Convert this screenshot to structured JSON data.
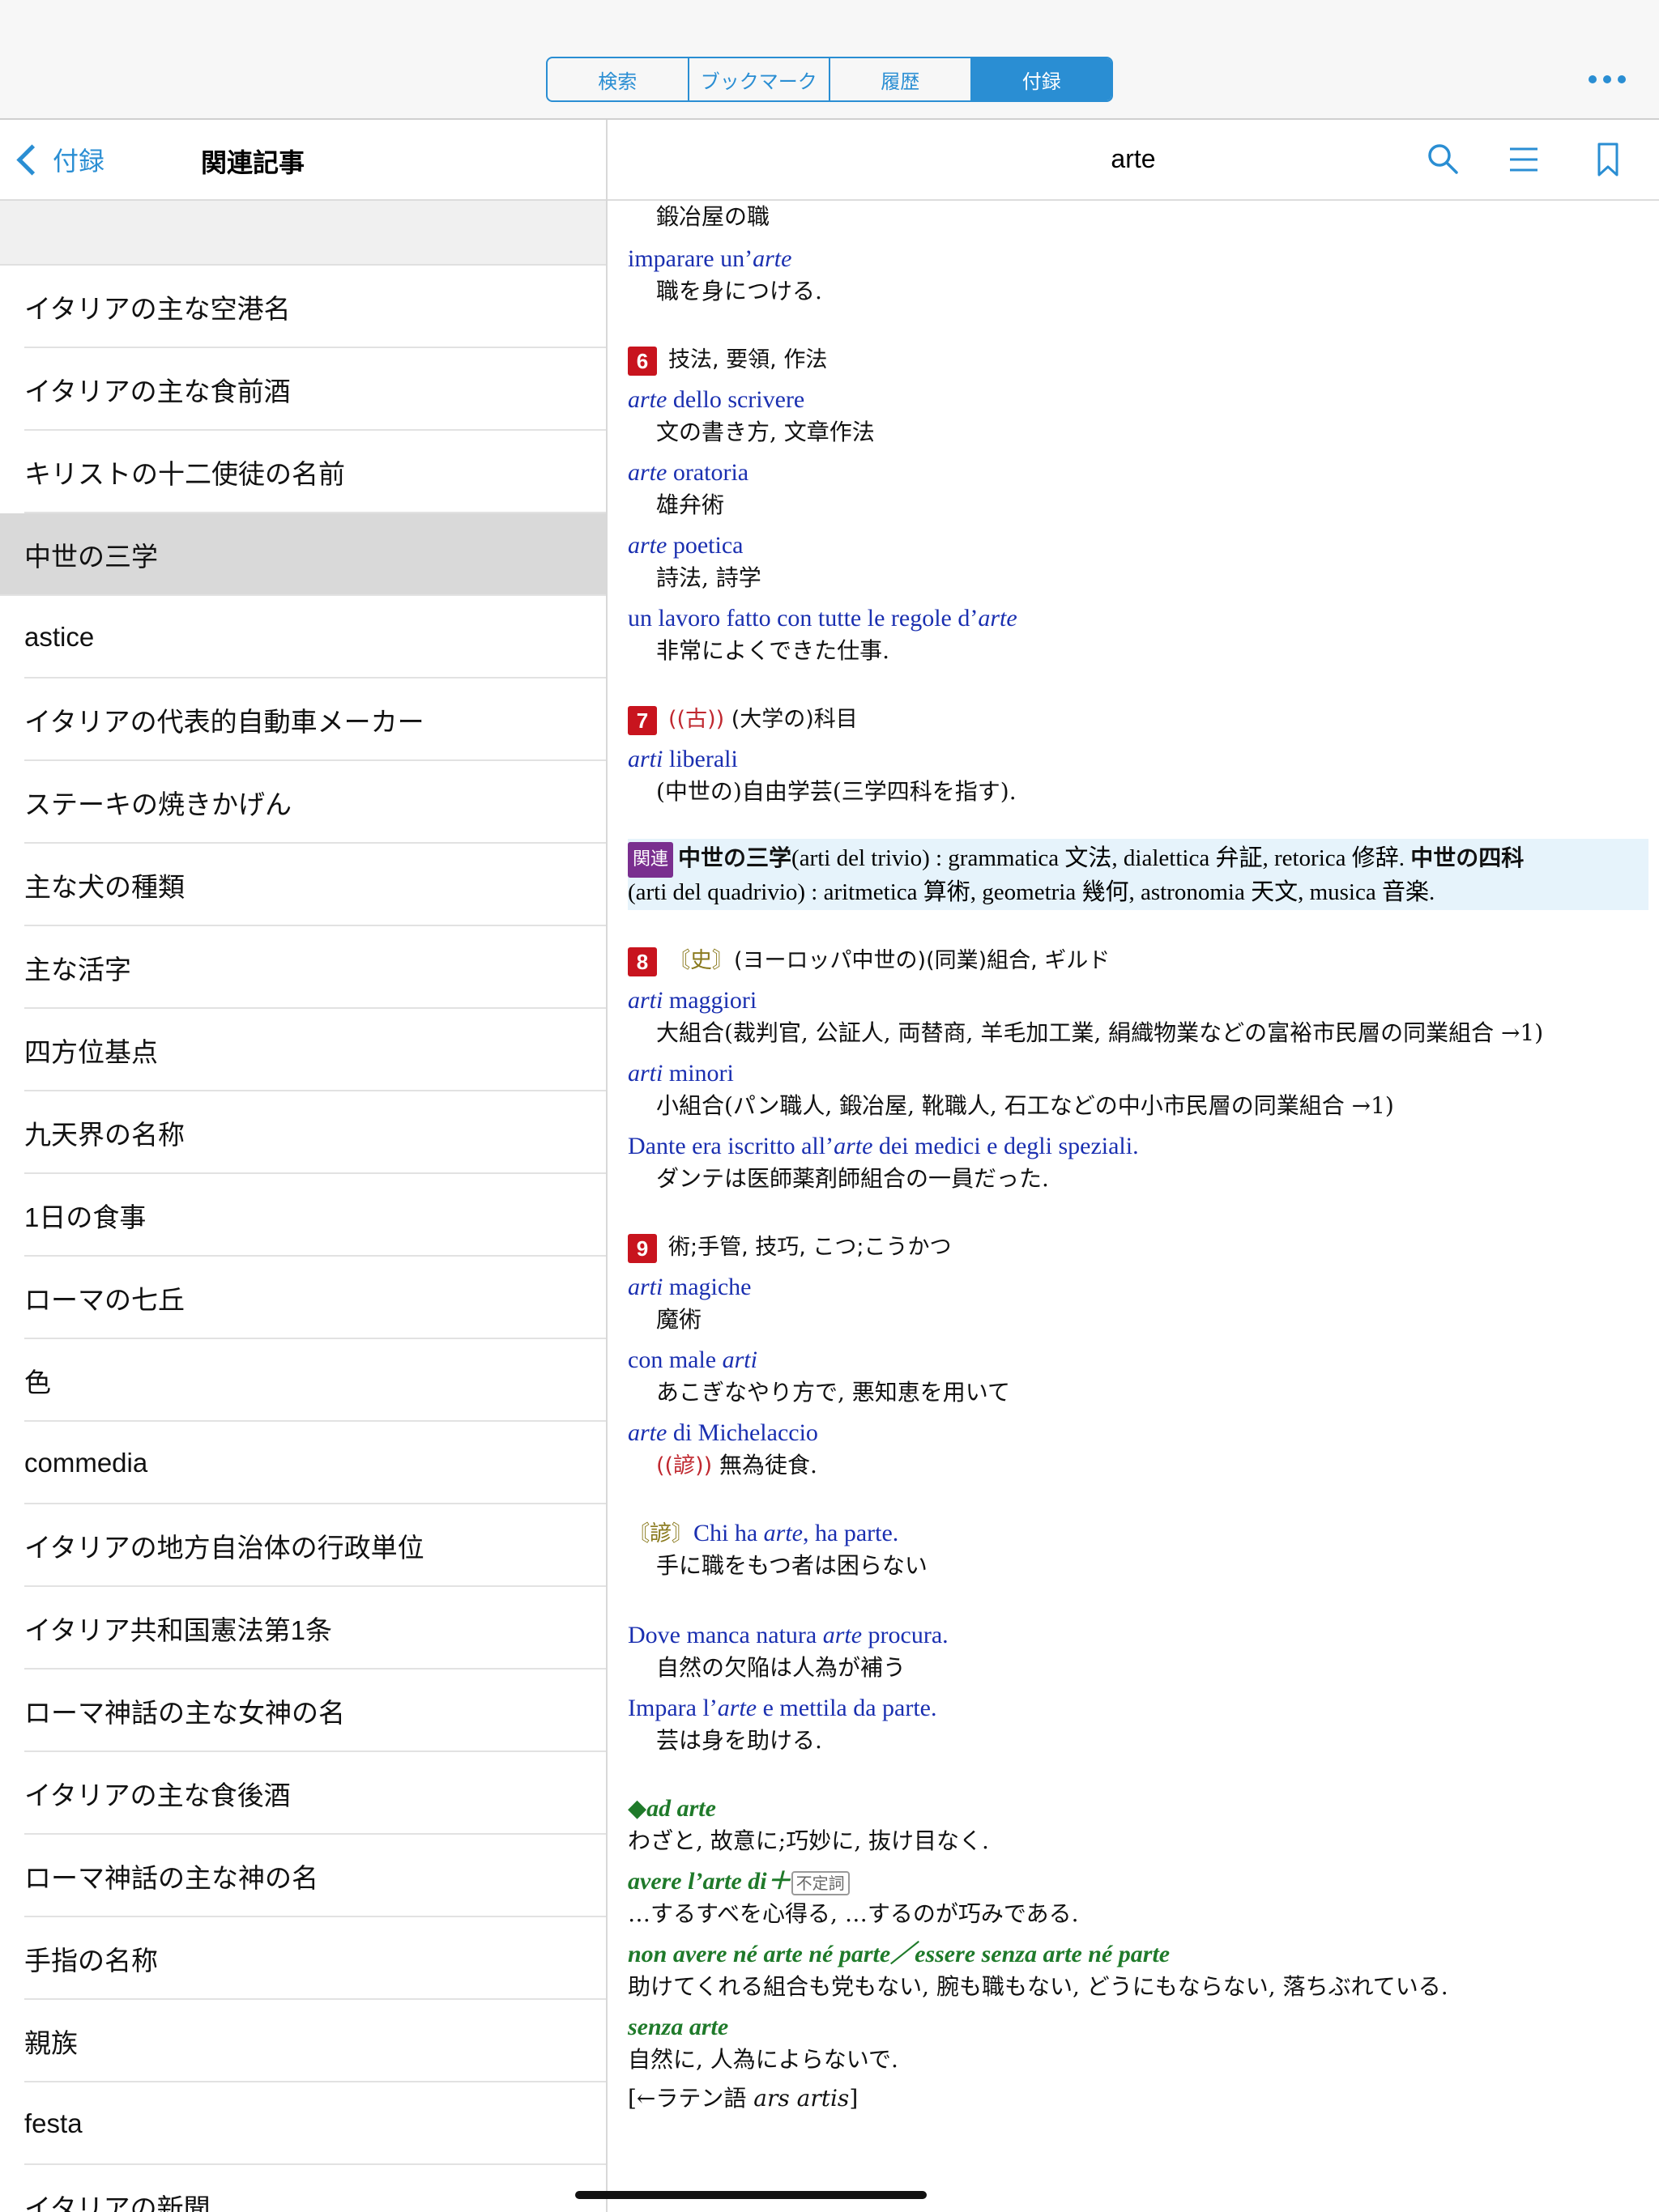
{
  "segments": [
    "検索",
    "ブックマーク",
    "履歴",
    "付録"
  ],
  "sidebar": {
    "back_label": "付録",
    "title": "関連記事",
    "items": [
      "イタリアの主な空港名",
      "イタリアの主な食前酒",
      "キリストの十二使徒の名前",
      "中世の三学",
      "astice",
      "イタリアの代表的自動車メーカー",
      "ステーキの焼きかげん",
      "主な犬の種類",
      "主な活字",
      "四方位基点",
      "九天界の名称",
      "1日の食事",
      "ローマの七丘",
      "色",
      "commedia",
      "イタリアの地方自治体の行政単位",
      "イタリア共和国憲法第1条",
      "ローマ神話の主な女神の名",
      "イタリアの主な食後酒",
      "ローマ神話の主な神の名",
      "手指の名称",
      "親族",
      "festa",
      "イタリアの新聞"
    ]
  },
  "content": {
    "title": "arte",
    "l1": "鍛冶屋の職",
    "l2a": "imparare un’",
    "l2b": "arte",
    "l3": "職を身につける.",
    "n6": "6",
    "s6": "技法, 要領, 作法",
    "l5a": "arte",
    "l5b": " dello scrivere",
    "l6": "文の書き方, 文章作法",
    "l7a": "arte",
    "l7b": " oratoria",
    "l8": "雄弁術",
    "l9a": "arte",
    "l9b": " poetica",
    "l10": "詩法, 詩学",
    "l11a": "un lavoro fatto con tutte le regole d’",
    "l11b": "arte",
    "l12": "非常によくできた仕事.",
    "n7": "7",
    "s7a": "((古))",
    "s7b": " (大学の)科目",
    "l14a": "arti",
    "l14b": " liberali",
    "l15": "(中世の)自由学芸(三学四科を指す).",
    "rel_badge": "関連",
    "rel1a": "中世の三学",
    "rel1b": "(arti del trivio) : grammatica 文法, dialettica 弁証, retorica 修辞. ",
    "rel1c": "中世の四科",
    "rel2": "(arti del quadrivio) : aritmetica 算術, geometria 幾何, astronomia 天文, musica 音楽.",
    "n8": "8",
    "s8a": "〘史〙",
    "s8b": "(ヨーロッパ中世の)(同業)組合, ギルド",
    "l18a": "arti",
    "l18b": " maggiori",
    "l19": "大組合(裁判官, 公証人, 両替商, 羊毛加工業, 絹織物業などの富裕市民層の同業組合 →1)",
    "l20a": "arti",
    "l20b": " minori",
    "l21": "小組合(パン職人, 鍛冶屋, 靴職人, 石工などの中小市民層の同業組合 →1)",
    "l22a": "Dante era iscritto all’",
    "l22b": "arte",
    "l22c": " dei medici e degli speziali.",
    "l23": "ダンテは医師薬剤師組合の一員だった.",
    "n9": "9",
    "s9": "術;手管, 技巧, こつ;こうかつ",
    "l25a": "arti",
    "l25b": " magiche",
    "l26": "魔術",
    "l27a": "con male ",
    "l27b": "arti",
    "l28": "あこぎなやり方で, 悪知恵を用いて",
    "l29a": "arte",
    "l29b": " di Michelaccio",
    "l30a": "((諺))",
    "l30b": " 無為徒食.",
    "l31a": "〘諺〙",
    "l31b": "Chi ha ",
    "l31c": "arte",
    "l31d": ", ha parte.",
    "l32": "手に職をもつ者は困らない",
    "l33a": "Dove manca natura ",
    "l33b": "arte",
    "l33c": " procura.",
    "l34": "自然の欠陥は人為が補う",
    "l35a": "Impara l’",
    "l35b": "arte",
    "l35c": " e mettila da parte.",
    "l36": "芸は身を助ける.",
    "l37": "◆ad arte",
    "l38": "わざと, 故意に;巧妙に, 抜け目なく.",
    "l39a": "avere l’arte di＋",
    "l39b": "不定詞",
    "l40": "…するすべを心得る, …するのが巧みである.",
    "l41": "non avere né arte né parte／essere senza arte né parte",
    "l42": "助けてくれる組合も党もない, 腕も職もない, どうにもならない, 落ちぶれている.",
    "l43": "senza arte",
    "l44": "自然に, 人為によらないで.",
    "l45a": "[←ラテン語 ",
    "l45b": "ars artis",
    "l45c": "]"
  }
}
